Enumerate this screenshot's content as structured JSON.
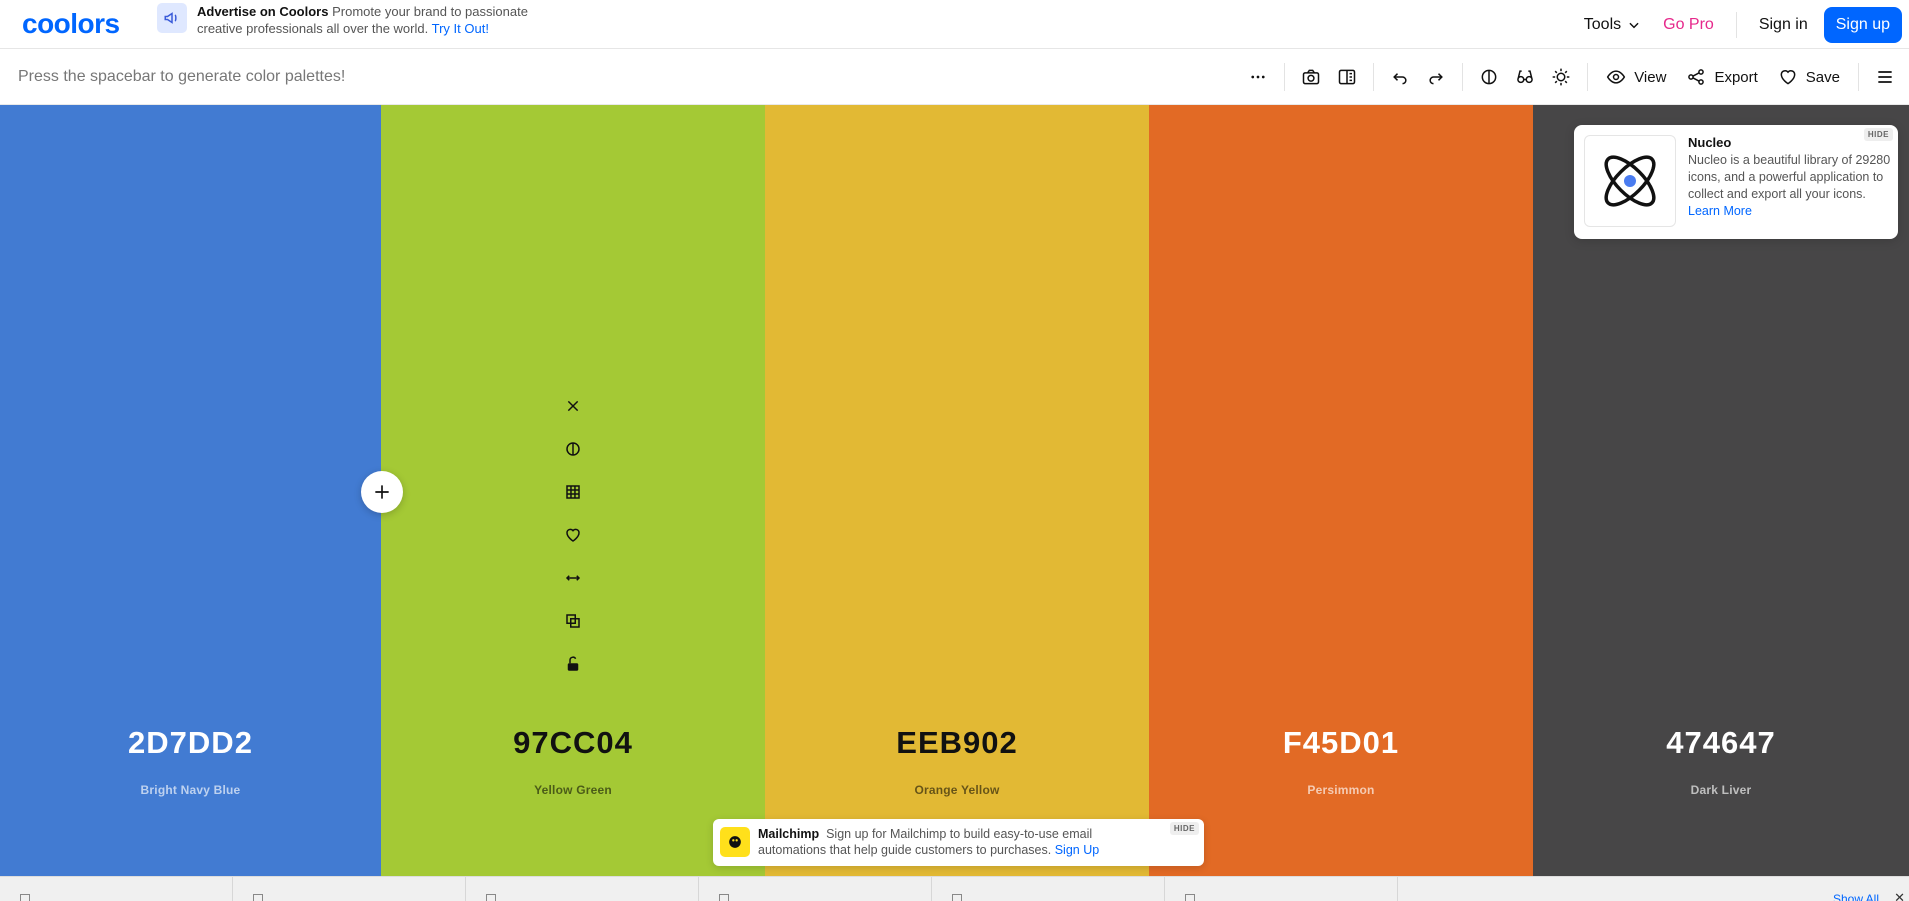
{
  "header": {
    "logo": "coolors",
    "ad": {
      "title": "Advertise on Coolors",
      "text": "Promote your brand to passionate creative professionals all over the world.",
      "link": "Try It Out!"
    },
    "tools_label": "Tools",
    "gopro_label": "Go Pro",
    "signin_label": "Sign in",
    "signup_label": "Sign up"
  },
  "toolbar": {
    "hint": "Press the spacebar to generate color palettes!",
    "view_label": "View",
    "export_label": "Export",
    "save_label": "Save"
  },
  "palette": {
    "colors": [
      {
        "hex": "2D7DD2",
        "name": "Bright Navy Blue",
        "swatch": "#427bd2"
      },
      {
        "hex": "97CC04",
        "name": "Yellow Green",
        "swatch": "#a4c935"
      },
      {
        "hex": "EEB902",
        "name": "Orange Yellow",
        "swatch": "#e2b934"
      },
      {
        "hex": "F45D01",
        "name": "Persimmon",
        "swatch": "#e26a25"
      },
      {
        "hex": "474647",
        "name": "Dark Liver",
        "swatch": "#474647"
      }
    ]
  },
  "nucleo_ad": {
    "title": "Nucleo",
    "text": "Nucleo is a beautiful library of 29280 icons, and a powerful application to collect and export all your icons.",
    "link": "Learn More",
    "hide": "HIDE"
  },
  "mailchimp_ad": {
    "title": "Mailchimp",
    "text": "Sign up for Mailchimp to build easy-to-use email automations that help guide customers to purchases.",
    "link": "Sign Up",
    "hide": "HIDE"
  },
  "bottom_bar": {
    "show_all": "Show All"
  },
  "colors": {
    "brand": "#0066ff",
    "gopro": "#e6288b"
  }
}
